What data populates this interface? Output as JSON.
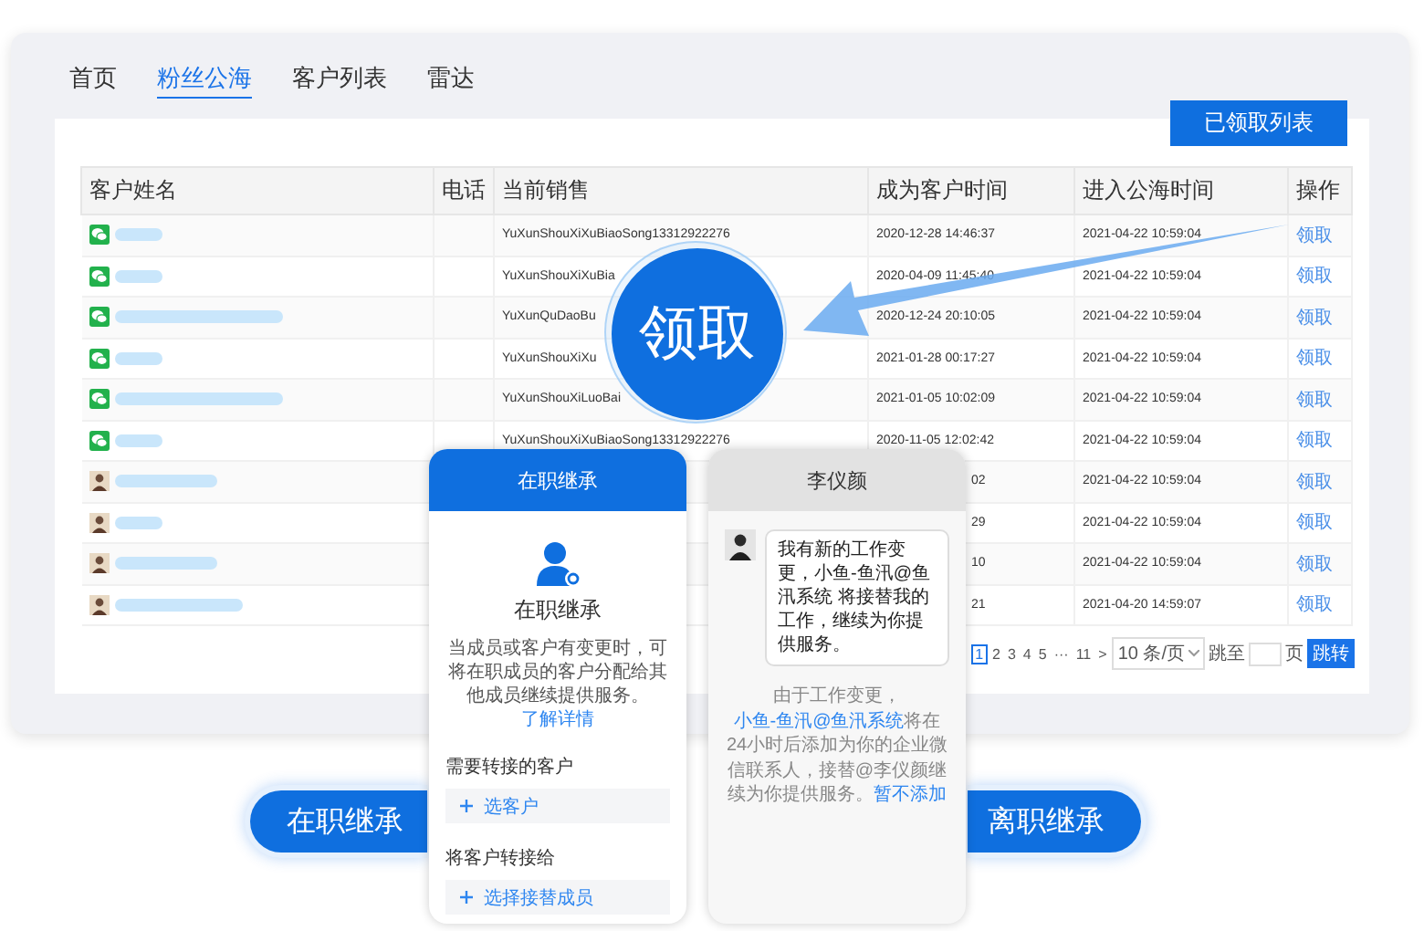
{
  "tabs": [
    {
      "label": "首页",
      "selected": false
    },
    {
      "label": "粉丝公海",
      "selected": true
    },
    {
      "label": "客户列表",
      "selected": false
    },
    {
      "label": "雷达",
      "selected": false
    }
  ],
  "claimed_list_button": "已领取列表",
  "table": {
    "columns": [
      "客户姓名",
      "电话",
      "当前销售",
      "成为客户时间",
      "进入公海时间",
      "操作"
    ],
    "rows": [
      {
        "avatar": {
          "kind": "wechat"
        },
        "sales": "YuXunShouXiXuBiaoSong13312922276",
        "became": "2020-12-28 14:46:37",
        "entered": "2021-04-22 10:59:04",
        "action": "领取"
      },
      {
        "avatar": {
          "kind": "wechat"
        },
        "sales": "YuXunShouXiXuBia",
        "became": "2020-04-09 11:45:40",
        "entered": "2021-04-22 10:59:04",
        "action": "领取"
      },
      {
        "avatar": {
          "kind": "wechat"
        },
        "sales": "YuXunQuDaoBu",
        "became": "2020-12-24 20:10:05",
        "entered": "2021-04-22 10:59:04",
        "action": "领取"
      },
      {
        "avatar": {
          "kind": "wechat"
        },
        "sales": "YuXunShouXiXu",
        "became": "2021-01-28 00:17:27",
        "entered": "2021-04-22 10:59:04",
        "action": "领取"
      },
      {
        "avatar": {
          "kind": "wechat"
        },
        "sales": "YuXunShouXiLuoBai",
        "became": "2021-01-05 10:02:09",
        "entered": "2021-04-22 10:59:04",
        "action": "领取"
      },
      {
        "avatar": {
          "kind": "wechat"
        },
        "sales": "YuXunShouXiXuBiaoSong13312922276",
        "became": "2020-11-05 12:02:42",
        "entered": "2021-04-22 10:59:04",
        "action": "领取"
      },
      {
        "avatar": {
          "kind": "photo"
        },
        "became": "02",
        "entered": "2021-04-22 10:59:04",
        "action": "领取"
      },
      {
        "avatar": {
          "kind": "photo"
        },
        "became": "29",
        "entered": "2021-04-22 10:59:04",
        "action": "领取"
      },
      {
        "avatar": {
          "kind": "photo"
        },
        "became": "10",
        "entered": "2021-04-22 10:59:04",
        "action": "领取"
      },
      {
        "avatar": {
          "kind": "photo"
        },
        "became": "21",
        "entered": "2021-04-20 14:59:07",
        "action": "领取"
      }
    ]
  },
  "pagination": {
    "pages": [
      {
        "label": "1",
        "selected": true
      },
      {
        "label": "2",
        "selected": false
      },
      {
        "label": "3",
        "selected": false
      },
      {
        "label": "4",
        "selected": false
      },
      {
        "label": "5",
        "selected": false
      },
      {
        "label": "···",
        "selected": false
      },
      {
        "label": "11",
        "selected": false
      }
    ],
    "next": ">",
    "page_size": "10 条/页",
    "goto_label": "跳至",
    "page_unit": "页",
    "goto_button": "跳转"
  },
  "callout": "领取",
  "active_card": {
    "header": "在职继承",
    "title": "在职继承",
    "description": "当成员或客户有变更时，可将在职成员的客户分配给其他成员继续提供服务。",
    "link": "了解详情",
    "sections": [
      {
        "label": "需要转接的客户",
        "button": "选客户"
      },
      {
        "label": "将客户转接给",
        "button": "选择接替成员"
      }
    ]
  },
  "resigned_card": {
    "header": "李仪颜",
    "message": "我有新的工作变更，小鱼-鱼汛@鱼汛系统 将接替我的工作，继续为你提供服务。",
    "notice": [
      {
        "text": "由于工作变更，",
        "link": false
      },
      {
        "text": "小鱼-鱼汛@鱼汛系统",
        "link": true
      },
      {
        "text": "将在24小时后添加为你的企业微信联系人，接替@李仪颜继续为你提供服务。",
        "link": false
      },
      {
        "text": "暂不添加",
        "link": true
      }
    ]
  },
  "bottom_buttons": [
    "在职继承",
    "离职继承"
  ]
}
